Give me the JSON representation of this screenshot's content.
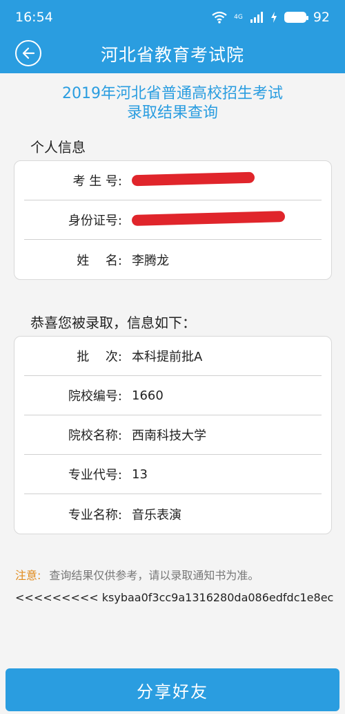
{
  "status_bar": {
    "time": "16:54",
    "network": "4G",
    "battery_level": "92"
  },
  "header": {
    "title": "河北省教育考试院",
    "back_icon": "back-arrow-circle-icon"
  },
  "query_title": {
    "line1": "2019年河北省普通高校招生考试",
    "line2": "录取结果查询"
  },
  "personal_info": {
    "section_title": "个人信息",
    "rows": [
      {
        "label": "考 生 号:",
        "value": ""
      },
      {
        "label": "身份证号:",
        "value": ""
      },
      {
        "label": "姓　 名:",
        "value": "李腾龙"
      }
    ]
  },
  "admission_info": {
    "section_title": "恭喜您被录取，信息如下：",
    "rows": [
      {
        "label": "批　 次:",
        "value": "本科提前批A"
      },
      {
        "label": "院校编号:",
        "value": "1660"
      },
      {
        "label": "院校名称:",
        "value": "西南科技大学"
      },
      {
        "label": "专业代号:",
        "value": "13"
      },
      {
        "label": "专业名称:",
        "value": "音乐表演"
      }
    ]
  },
  "note": {
    "label": "注意:",
    "text": "查询结果仅供参考，请以录取通知书为准。"
  },
  "code_line": "<<<<<<<<< ksybaa0f3cc9a1316280da086edfdc1e8ec",
  "share_button": {
    "label": "分享好友"
  },
  "colors": {
    "brand": "#2a9de0",
    "note": "#e08a1c",
    "redaction": "#e0252b"
  }
}
